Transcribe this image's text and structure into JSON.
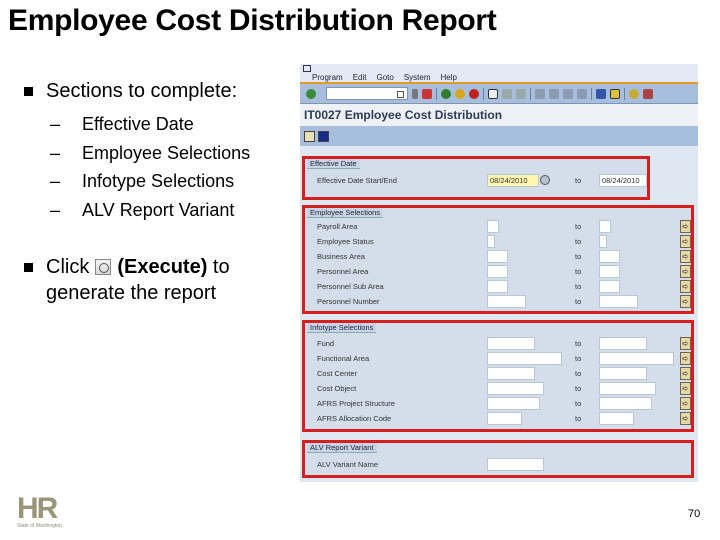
{
  "slide": {
    "title": "Employee Cost Distribution Report",
    "bullet1": "Sections to complete:",
    "sub_items": [
      "Effective Date",
      "Employee Selections",
      "Infotype Selections",
      "ALV Report Variant"
    ],
    "bullet2_pre": "Click",
    "bullet2_bold": "(Execute)",
    "bullet2_post": " to",
    "bullet2_line2": "generate the report",
    "page_number": "70",
    "logo_text": "HR",
    "logo_sub": "State of Washington"
  },
  "sap": {
    "menu": [
      "Program",
      "Edit",
      "Goto",
      "System",
      "Help"
    ],
    "screen_title": "IT0027 Employee Cost Distribution",
    "effective_date": {
      "title": "Effective Date",
      "label": "Effective Date Start/End",
      "from": "08/24/2010",
      "to_label": "to",
      "to": "08/24/2010"
    },
    "employee_selections": {
      "title": "Employee Selections",
      "rows": [
        {
          "label": "Payroll Area",
          "to": "to"
        },
        {
          "label": "Employee Status",
          "to": "to"
        },
        {
          "label": "Business Area",
          "to": "to"
        },
        {
          "label": "Personnel Area",
          "to": "to"
        },
        {
          "label": "Personnel Sub Area",
          "to": "to"
        },
        {
          "label": "Personnel Number",
          "to": "to"
        }
      ]
    },
    "infotype_selections": {
      "title": "Infotype Selections",
      "rows": [
        {
          "label": "Fund",
          "to": "to"
        },
        {
          "label": "Functional Area",
          "to": "to"
        },
        {
          "label": "Cost Center",
          "to": "to"
        },
        {
          "label": "Cost Object",
          "to": "to"
        },
        {
          "label": "AFRS Project Structure",
          "to": "to"
        },
        {
          "label": "AFRS Allocation Code",
          "to": "to"
        }
      ]
    },
    "alv": {
      "title": "ALV Report Variant",
      "label": "ALV Variant Name"
    },
    "colors": {
      "highlight": "#d61e1e",
      "toolbar": "#a7bfdc",
      "panel": "#d3deea"
    }
  }
}
